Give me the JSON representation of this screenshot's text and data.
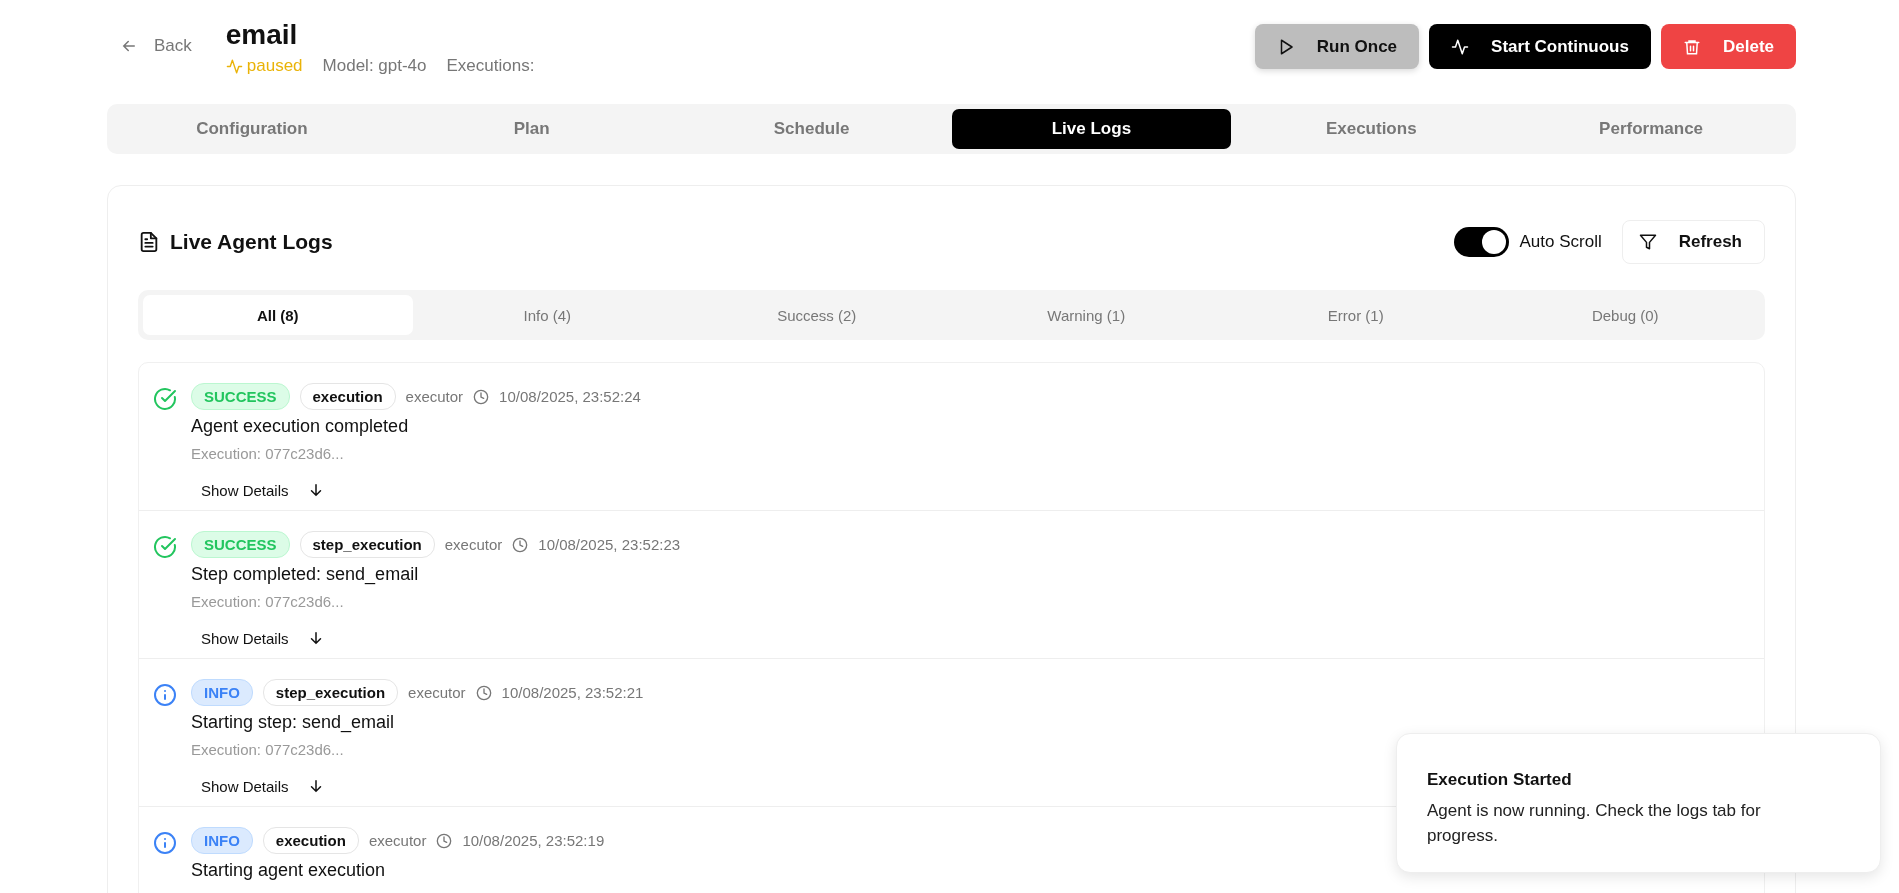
{
  "header": {
    "back": "Back",
    "title": "email",
    "status": {
      "kind": "paused",
      "label": "paused"
    },
    "model": "Model: gpt-4o",
    "executions": "Executions:"
  },
  "actions": [
    {
      "kind": "run",
      "label": "Run Once",
      "disabled": true
    },
    {
      "kind": "continuous",
      "label": "Start Continuous",
      "disabled": false
    },
    {
      "kind": "delete",
      "label": "Delete",
      "disabled": false
    }
  ],
  "tabs": [
    {
      "label": "Configuration",
      "selected": false
    },
    {
      "label": "Plan",
      "selected": false
    },
    {
      "label": "Schedule",
      "selected": false
    },
    {
      "label": "Live Logs",
      "selected": true
    },
    {
      "label": "Executions",
      "selected": false
    },
    {
      "label": "Performance",
      "selected": false
    }
  ],
  "panel": {
    "title": "Live Agent Logs",
    "auto_scroll": {
      "label": "Auto Scroll",
      "on": true
    },
    "refresh": "Refresh"
  },
  "filters": [
    {
      "label": "All (8)",
      "selected": true
    },
    {
      "label": "Info (4)",
      "selected": false
    },
    {
      "label": "Success (2)",
      "selected": false
    },
    {
      "label": "Warning (1)",
      "selected": false
    },
    {
      "label": "Error (1)",
      "selected": false
    },
    {
      "label": "Debug (0)",
      "selected": false
    }
  ],
  "logs": [
    {
      "kind": "success",
      "badge": "SUCCESS",
      "category": "execution",
      "source": "executor",
      "timestamp": "10/08/2025, 23:52:24",
      "message": "Agent execution completed",
      "execution": "Execution: 077c23d6...",
      "details": "Show Details"
    },
    {
      "kind": "success",
      "badge": "SUCCESS",
      "category": "step_execution",
      "source": "executor",
      "timestamp": "10/08/2025, 23:52:23",
      "message": "Step completed: send_email",
      "execution": "Execution: 077c23d6...",
      "details": "Show Details"
    },
    {
      "kind": "info",
      "badge": "INFO",
      "category": "step_execution",
      "source": "executor",
      "timestamp": "10/08/2025, 23:52:21",
      "message": "Starting step: send_email",
      "execution": "Execution: 077c23d6...",
      "details": "Show Details"
    },
    {
      "kind": "info",
      "badge": "INFO",
      "category": "execution",
      "source": "executor",
      "timestamp": "10/08/2025, 23:52:19",
      "message": "Starting agent execution"
    }
  ],
  "toast": {
    "title": "Execution Started",
    "message": "Agent is now running. Check the logs tab for progress."
  }
}
